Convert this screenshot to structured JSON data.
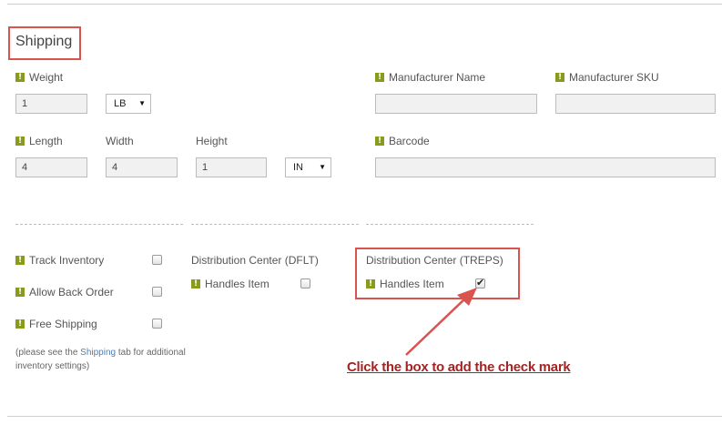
{
  "section_title": "Shipping",
  "weight": {
    "label": "Weight",
    "value": "1",
    "unit": "LB"
  },
  "manufacturer_name": {
    "label": "Manufacturer Name",
    "value": ""
  },
  "manufacturer_sku": {
    "label": "Manufacturer SKU",
    "value": ""
  },
  "dimensions": {
    "length": {
      "label": "Length",
      "value": "4"
    },
    "width": {
      "label": "Width",
      "value": "4"
    },
    "height": {
      "label": "Height",
      "value": "1"
    },
    "unit": "IN"
  },
  "barcode": {
    "label": "Barcode",
    "value": ""
  },
  "inventory": {
    "track_inventory": {
      "label": "Track Inventory",
      "checked": false
    },
    "allow_back_order": {
      "label": "Allow Back Order",
      "checked": false
    },
    "free_shipping": {
      "label": "Free Shipping",
      "checked": false
    },
    "note_prefix": "(please see the ",
    "note_link": "Shipping",
    "note_suffix": " tab for additional",
    "note_line2": "inventory settings)"
  },
  "dc_dflt": {
    "title": "Distribution Center (DFLT)",
    "handles_label": "Handles Item",
    "checked": false
  },
  "dc_treps": {
    "title": "Distribution Center (TREPS)",
    "handles_label": "Handles Item",
    "checked": true
  },
  "annotation": {
    "text": "Click the box to add the check mark"
  },
  "info_glyph": "!",
  "check_glyph": "✔",
  "caret_glyph": "▼",
  "colors": {
    "accent_red": "#d9534f",
    "callout_red": "#a52323",
    "info_icon": "#8a9a1a"
  }
}
